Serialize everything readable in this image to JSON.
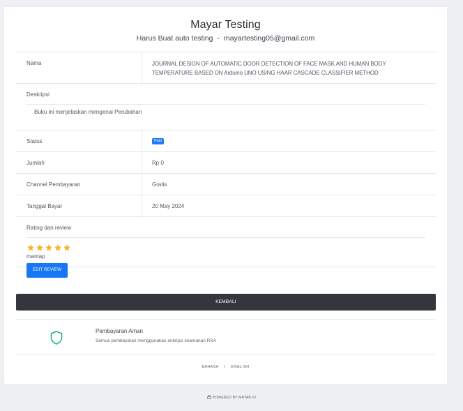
{
  "header": {
    "title": "Mayar Testing",
    "subtitle_name": "Harus Buat auto testing",
    "subtitle_sep": "-",
    "subtitle_email": "mayartesting05@gmail.com"
  },
  "details": {
    "nama_label": "Nama",
    "nama_value": "JOURNAL DESIGN OF AUTOMATIC DOOR DETECTION OF FACE MASK AND HUMAN BODY TEMPERATURE BASED ON Arduino UNO USING HAAR CASCADE CLASSIFIER METHOD",
    "deskripsi_label": "Deskripsi",
    "deskripsi_value": "Buku ini menjelaskan mengenai Perubahan",
    "status_label": "Status",
    "status_value": "Paid",
    "jumlah_label": "Jumlah",
    "jumlah_value": "Rp 0",
    "channel_label": "Channel Pembayaran",
    "channel_value": "Gratis",
    "tanggal_label": "Tanggal Bayar",
    "tanggal_value": "20 May 2024"
  },
  "rating": {
    "label": "Rating dan review",
    "stars": 5,
    "review_text": "mantap",
    "edit_button": "EDIT REVIEW"
  },
  "kembali_button": "KEMBALI",
  "secure": {
    "title": "Pembayaran Aman",
    "description": "Semua pembayaran menggunakan enkripsi keamanan RSA"
  },
  "language": {
    "bahasa": "BAHASA",
    "sep": "|",
    "english": "ENGLISH"
  },
  "footer": {
    "powered": "POWERED BY MAYAR.ID"
  },
  "colors": {
    "accent": "#1877f2",
    "dark_button": "#33373d",
    "star": "#f5b52e",
    "shield": "#1bb77e"
  }
}
